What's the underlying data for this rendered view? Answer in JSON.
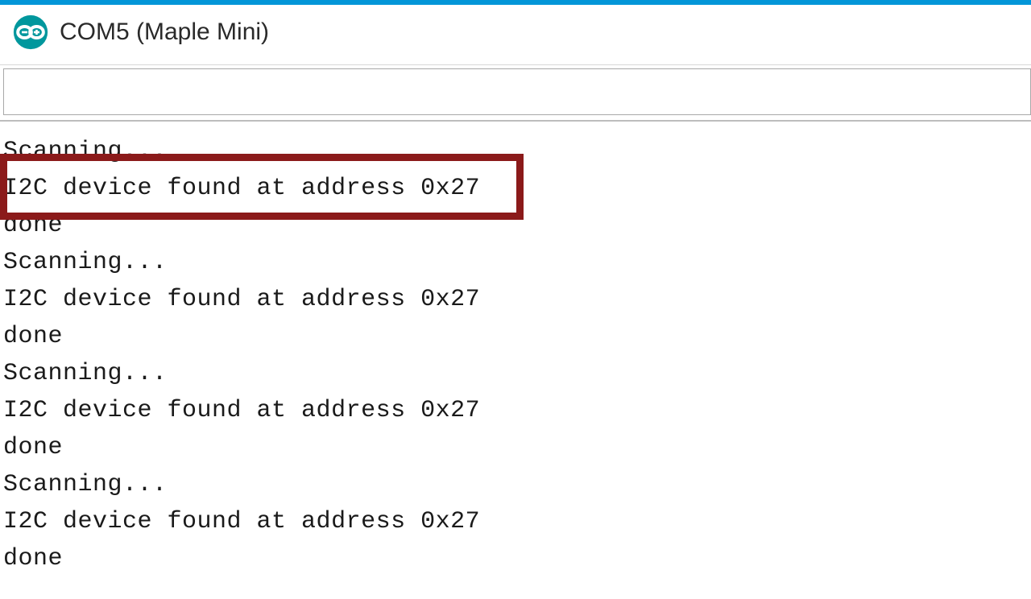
{
  "window": {
    "title": "COM5 (Maple Mini)"
  },
  "input": {
    "value": "",
    "placeholder": ""
  },
  "highlight": {
    "target_line_index": 1
  },
  "output_lines": [
    "Scanning...",
    "I2C device found at address 0x27",
    "done",
    "Scanning...",
    "I2C device found at address 0x27",
    "done",
    "Scanning...",
    "I2C device found at address 0x27",
    "done",
    "Scanning...",
    "I2C device found at address 0x27",
    "done"
  ],
  "colors": {
    "accent": "#0296d8",
    "icon_teal": "#00979d",
    "highlight_border": "#8b1a1a"
  }
}
